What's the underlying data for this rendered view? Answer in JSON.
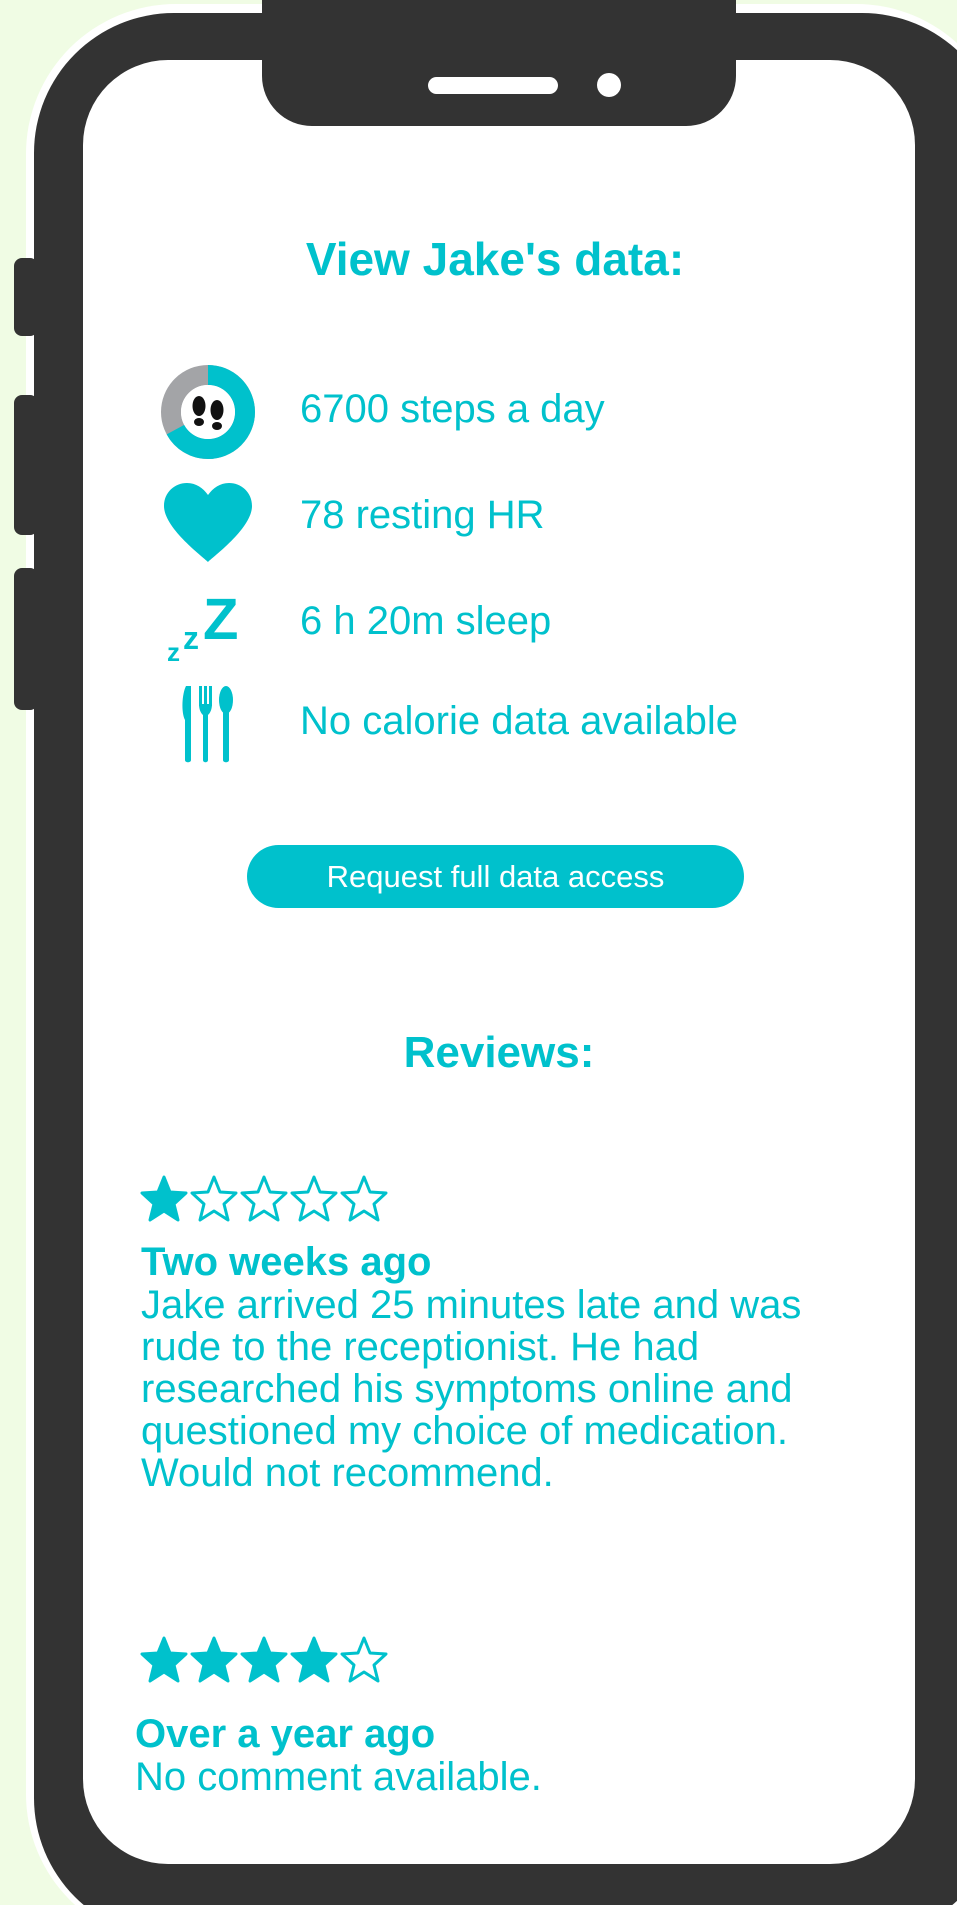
{
  "header": {
    "title": "View Jake's data:"
  },
  "stats": [
    {
      "icon": "footsteps-progress-icon",
      "text": "6700 steps a day"
    },
    {
      "icon": "heart-icon",
      "text": "78 resting HR"
    },
    {
      "icon": "sleep-zzz-icon",
      "text": "6 h 20m sleep"
    },
    {
      "icon": "cutlery-icon",
      "text": "No calorie data available"
    }
  ],
  "steps_progress": 0.67,
  "sleep_icon_letters": {
    "small": "z",
    "medium": "z",
    "large": "Z"
  },
  "request_button": {
    "label": "Request full data access"
  },
  "reviews": {
    "title": "Reviews:",
    "items": [
      {
        "rating": 1,
        "max_rating": 5,
        "when": "Two weeks ago",
        "comment": "Jake arrived 25 minutes late and was rude to the receptionist. He had researched his symptoms online and questioned my choice of medication. Would not recommend."
      },
      {
        "rating": 4,
        "max_rating": 5,
        "when": "Over a year ago",
        "comment": "No comment available."
      }
    ]
  },
  "colors": {
    "accent": "#00c1cc",
    "phone_frame": "#333333",
    "background": "#f0fce4",
    "progress_track": "#a3a4a7"
  }
}
